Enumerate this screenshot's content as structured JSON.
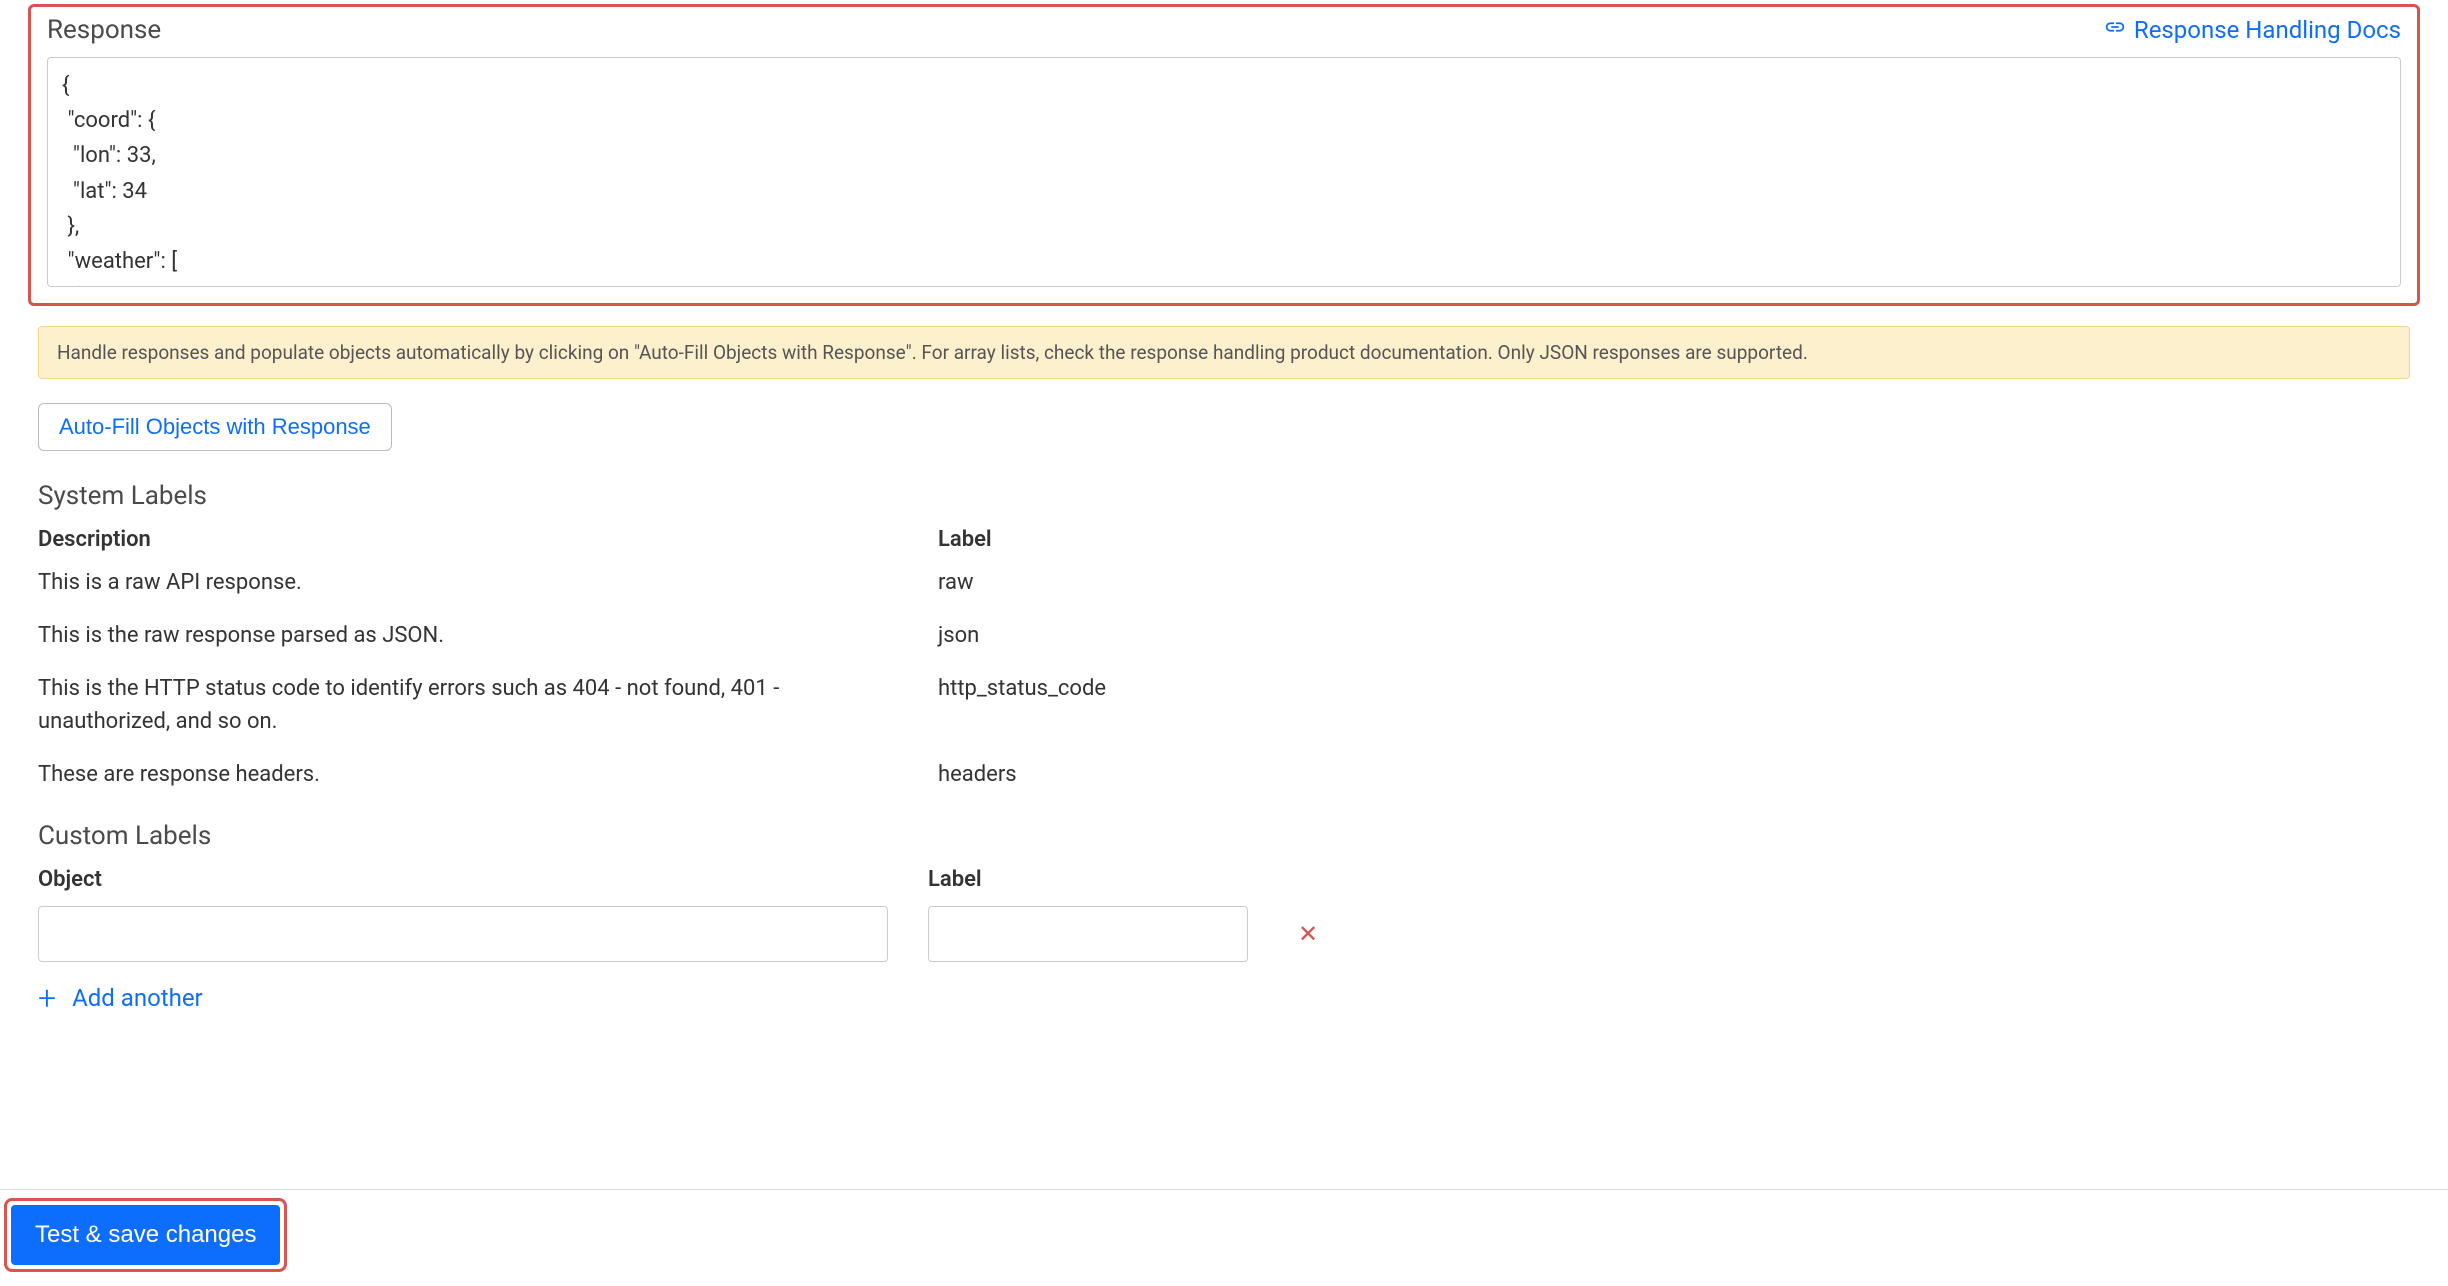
{
  "response_panel": {
    "title": "Response",
    "docs_link_text": "Response Handling Docs",
    "body_text": "{\n \"coord\": {\n  \"lon\": 33,\n  \"lat\": 34\n },\n \"weather\": [\n  {"
  },
  "info_banner": "Handle responses and populate objects automatically by clicking on \"Auto-Fill Objects with Response\". For array lists, check the response handling product documentation. Only JSON responses are supported.",
  "autofill_button": "Auto-Fill Objects with Response",
  "system_labels": {
    "title": "System Labels",
    "columns": {
      "description": "Description",
      "label": "Label"
    },
    "rows": [
      {
        "description": "This is a raw API response.",
        "label": "raw"
      },
      {
        "description": "This is the raw response parsed as JSON.",
        "label": "json"
      },
      {
        "description": "This is the HTTP status code to identify errors such as 404 - not found, 401 - unauthorized, and so on.",
        "label": "http_status_code"
      },
      {
        "description": "These are response headers.",
        "label": "headers"
      }
    ]
  },
  "custom_labels": {
    "title": "Custom Labels",
    "columns": {
      "object": "Object",
      "label": "Label"
    },
    "rows": [
      {
        "object": "",
        "label": ""
      }
    ],
    "add_another_text": "Add another"
  },
  "footer": {
    "test_save_button": "Test & save changes"
  }
}
